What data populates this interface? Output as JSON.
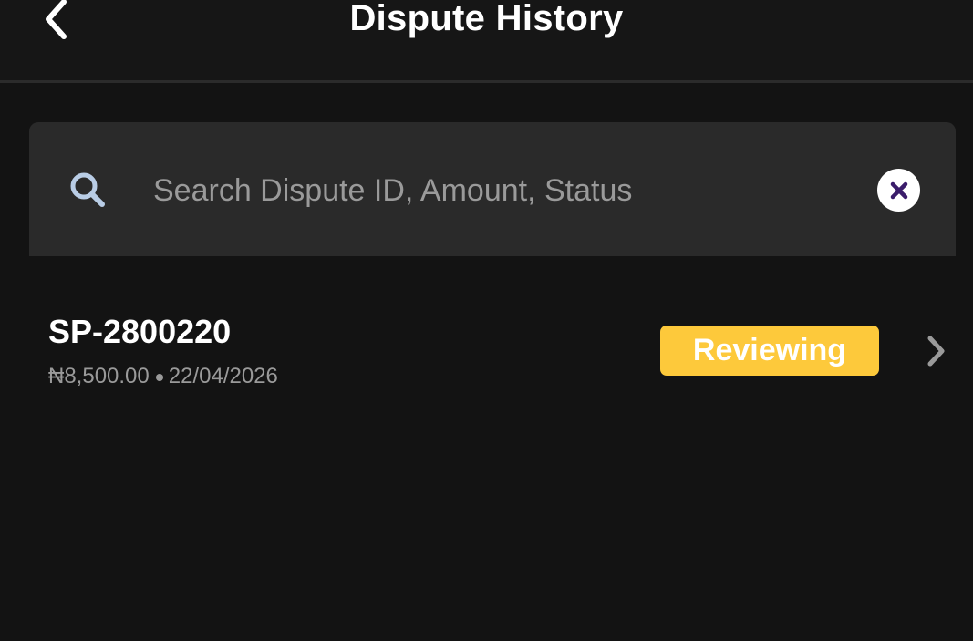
{
  "header": {
    "title": "Dispute History",
    "back_icon": "chevron-left-icon"
  },
  "search": {
    "placeholder": "Search Dispute ID, Amount, Status",
    "value": "",
    "search_icon": "search-icon",
    "clear_icon": "close-icon"
  },
  "disputes": [
    {
      "id": "SP-2800220",
      "amount": "₦8,500.00",
      "date": "22/04/2026",
      "status": "Reviewing",
      "status_color": "#fdc93b",
      "chevron_icon": "chevron-right-icon"
    }
  ],
  "colors": {
    "background": "#131313",
    "header_background": "#161616",
    "search_background": "#2a2a2a",
    "status_reviewing": "#fdc93b",
    "clear_icon_accent": "#3b1d6b",
    "search_icon_color": "#b9cde6"
  }
}
